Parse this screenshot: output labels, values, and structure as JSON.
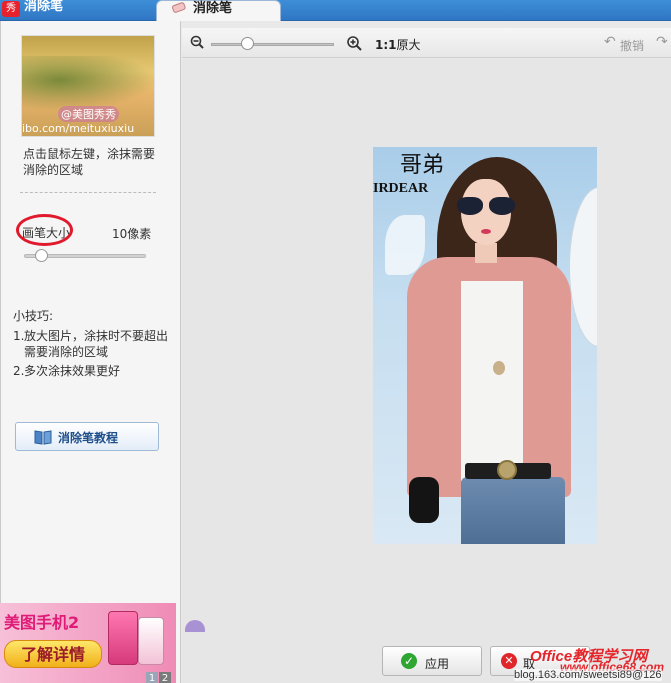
{
  "app": {
    "title": "消除笔",
    "logo_text": "秀"
  },
  "tab": {
    "label": "消除笔"
  },
  "left_panel": {
    "thumbnail": {
      "watermark": "@美图秀秀",
      "url_text": "ibo.com/meituxiuxiu"
    },
    "hint": "点击鼠标左键，涂抹需要消除的区域",
    "brush_size_label": "画笔大小",
    "brush_size_value": "10像素",
    "brush_size_level": 0.1,
    "tips_title": "小技巧:",
    "tips": [
      {
        "num": "1.",
        "text": "放大图片，涂抹时不要超出需要消除的区域"
      },
      {
        "num": "2.",
        "text": "多次涂抹效果更好"
      }
    ],
    "tutorial_button": "消除笔教程"
  },
  "ad": {
    "title": "美图手机2",
    "button": "了解详情",
    "pages": [
      "1",
      "2"
    ]
  },
  "toolbar": {
    "ratio_bold": "1:1",
    "ratio_label": "原大",
    "undo_label": "撤销"
  },
  "photo": {
    "bg_word": "IRDEAR",
    "bg_logo": "哥弟"
  },
  "bottom": {
    "apply_label": "应用",
    "cancel_label": "取"
  },
  "watermarks": {
    "office": "Office教程学习网",
    "office_url": "www.office68.com",
    "blog": "blog.163.com/sweetsi89@126"
  },
  "colors": {
    "title_bar": "#2f76c4",
    "highlight_ring": "#e01a2c",
    "apply_icon": "#2fa532",
    "cancel_icon": "#e0262b"
  }
}
